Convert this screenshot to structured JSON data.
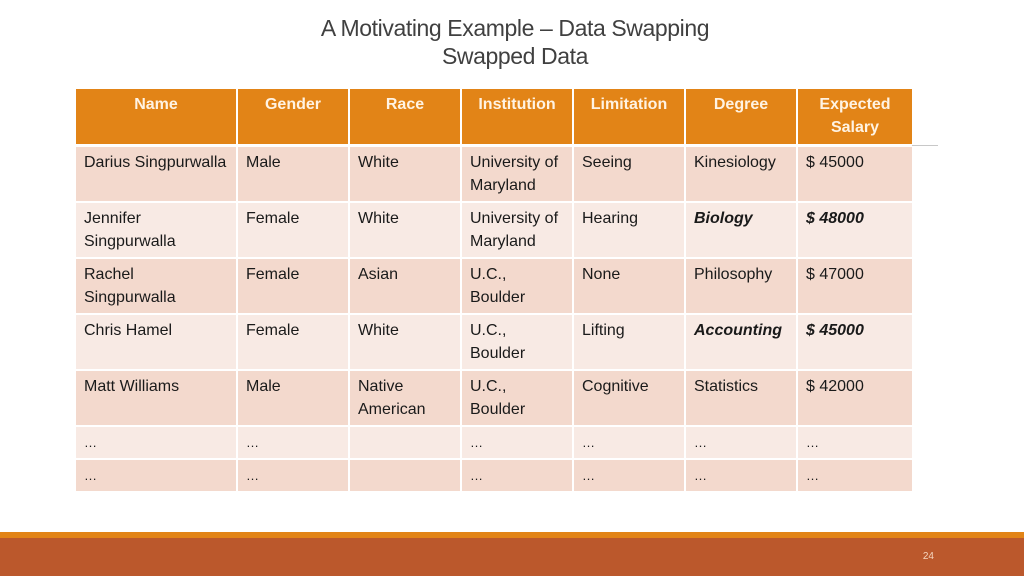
{
  "slide": {
    "title_line1": "A Motivating Example – Data Swapping",
    "title_line2": "Swapped Data",
    "page_number": "24",
    "colors": {
      "header_fill": "#e28417",
      "row_dark": "#f3d9cd",
      "row_light": "#f8eae4",
      "footer_band": "#bb582c",
      "footer_stripe": "#e28417"
    }
  },
  "table": {
    "headers": [
      "Name",
      "Gender",
      "Race",
      "Institution",
      "Limitation",
      "Degree",
      "Expected Salary"
    ],
    "rows": [
      {
        "cells": [
          "Darius Singpurwalla",
          "Male",
          "White",
          "University of Maryland",
          "Seeing",
          "Kinesiology",
          "$ 45000"
        ],
        "emphasized": []
      },
      {
        "cells": [
          "Jennifer Singpurwalla",
          "Female",
          "White",
          "University of Maryland",
          "Hearing",
          "Biology",
          "$ 48000"
        ],
        "emphasized": [
          5,
          6
        ]
      },
      {
        "cells": [
          "Rachel Singpurwalla",
          "Female",
          "Asian",
          "U.C., Boulder",
          "None",
          "Philosophy",
          "$ 47000"
        ],
        "emphasized": []
      },
      {
        "cells": [
          "Chris Hamel",
          "Female",
          "White",
          "U.C., Boulder",
          "Lifting",
          "Accounting",
          "$ 45000"
        ],
        "emphasized": [
          5,
          6
        ]
      },
      {
        "cells": [
          "Matt Williams",
          "Male",
          "Native American",
          "U.C., Boulder",
          "Cognitive",
          "Statistics",
          "$ 42000"
        ],
        "emphasized": []
      },
      {
        "cells": [
          "…",
          "…",
          "",
          "…",
          "…",
          "…",
          "…"
        ],
        "emphasized": []
      },
      {
        "cells": [
          "…",
          "…",
          "",
          "…",
          "…",
          "…",
          "…"
        ],
        "emphasized": []
      }
    ]
  }
}
